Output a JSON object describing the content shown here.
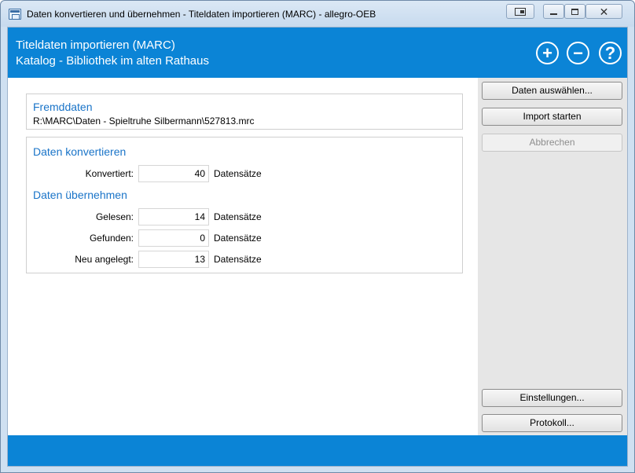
{
  "window": {
    "title": "Daten konvertieren und übernehmen - Titeldaten importieren (MARC) - allegro-OEB",
    "controls": [
      "restore-down-icon",
      "minimize-icon",
      "maximize-icon",
      "close-icon"
    ]
  },
  "header": {
    "title": "Titeldaten importieren (MARC)",
    "subtitle": "Katalog - Bibliothek im alten Rathaus",
    "icons": {
      "plus": "+",
      "minus": "−",
      "help": "?"
    }
  },
  "fremddaten": {
    "heading": "Fremddaten",
    "path": "R:\\MARC\\Daten - Spieltruhe Silbermann\\527813.mrc"
  },
  "konvertieren": {
    "heading": "Daten konvertieren",
    "rows": [
      {
        "label": "Konvertiert:",
        "value": "40",
        "unit": "Datensätze"
      }
    ]
  },
  "uebernehmen": {
    "heading": "Daten übernehmen",
    "rows": [
      {
        "label": "Gelesen:",
        "value": "14",
        "unit": "Datensätze"
      },
      {
        "label": "Gefunden:",
        "value": "0",
        "unit": "Datensätze"
      },
      {
        "label": "Neu angelegt:",
        "value": "13",
        "unit": "Datensätze"
      }
    ]
  },
  "sidebar": {
    "select_label": "Daten auswählen...",
    "start_label": "Import starten",
    "cancel_label": "Abbrechen",
    "settings_label": "Einstellungen...",
    "log_label": "Protokoll..."
  },
  "colors": {
    "accent": "#0b84d6",
    "heading": "#1a74c8",
    "sidebar": "#e6e6e6"
  }
}
